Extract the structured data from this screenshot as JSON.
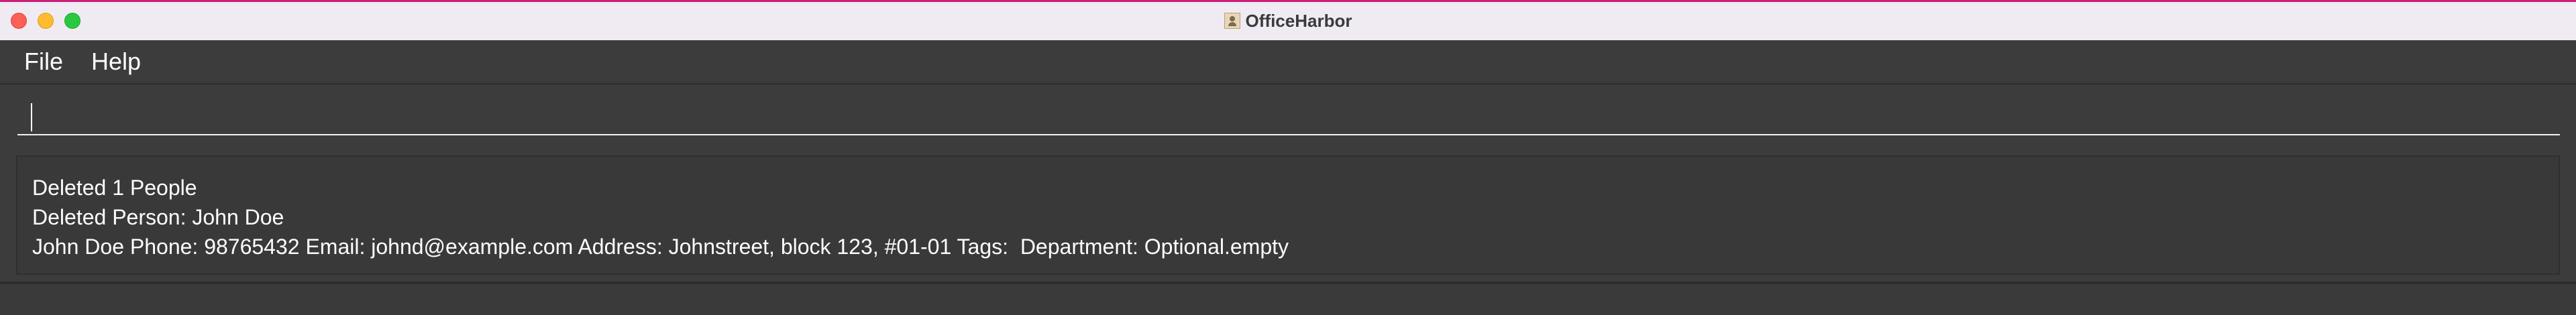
{
  "window": {
    "title": "OfficeHarbor",
    "app_icon": "contact-card-icon"
  },
  "menu": {
    "items": [
      {
        "label": "File"
      },
      {
        "label": "Help"
      }
    ]
  },
  "command_box": {
    "value": ""
  },
  "result": {
    "lines": [
      "Deleted 1 People",
      "Deleted Person: John Doe",
      "John Doe Phone: 98765432 Email: johnd@example.com Address: Johnstreet, block 123, #01-01 Tags:  Department: Optional.empty"
    ]
  },
  "colors": {
    "titlebar": "#f0ebf2",
    "background": "#3c3c3c",
    "text": "#ffffff",
    "close": "#fe5f57",
    "minimize": "#febc2e",
    "maximize": "#28c840"
  }
}
